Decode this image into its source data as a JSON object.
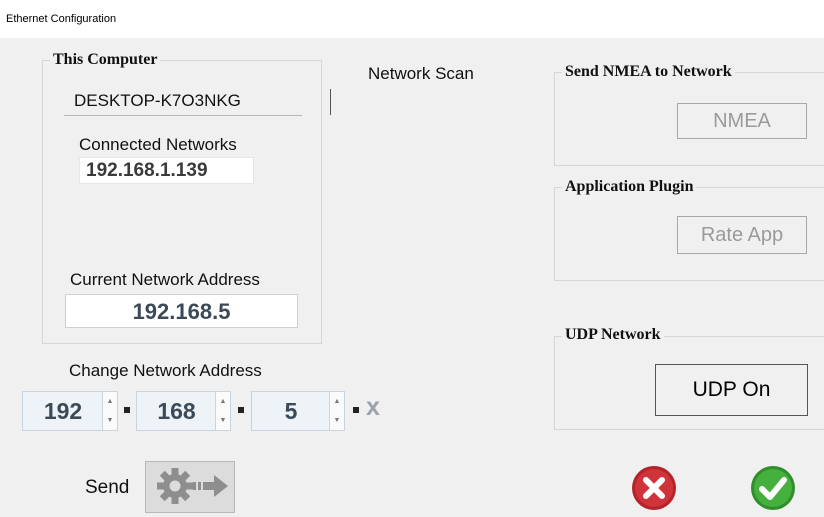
{
  "window": {
    "title": "Ethernet Configuration"
  },
  "this_computer": {
    "title": "This Computer",
    "hostname": "DESKTOP-K7O3NKG",
    "connected_label": "Connected Networks",
    "connected_ip": "192.168.1.139",
    "current_label": "Current Network Address",
    "current_address": "192.168.5"
  },
  "network_scan": {
    "label": "Network Scan"
  },
  "send_nmea": {
    "title": "Send NMEA to Network",
    "button": "NMEA"
  },
  "plugin": {
    "title": "Application Plugin",
    "button": "Rate App"
  },
  "udp": {
    "title": "UDP Network",
    "button": "UDP On"
  },
  "change_address": {
    "label": "Change Network Address",
    "octet1": "192",
    "octet2": "168",
    "octet3": "5",
    "octet4": "x"
  },
  "send": {
    "label": "Send"
  },
  "icons": {
    "send_button": "gear-arrow-icon",
    "cancel_button": "red-x-circle-icon",
    "ok_button": "green-check-circle-icon"
  },
  "colors": {
    "cancel": "#c0272d",
    "ok": "#3aaa35"
  }
}
